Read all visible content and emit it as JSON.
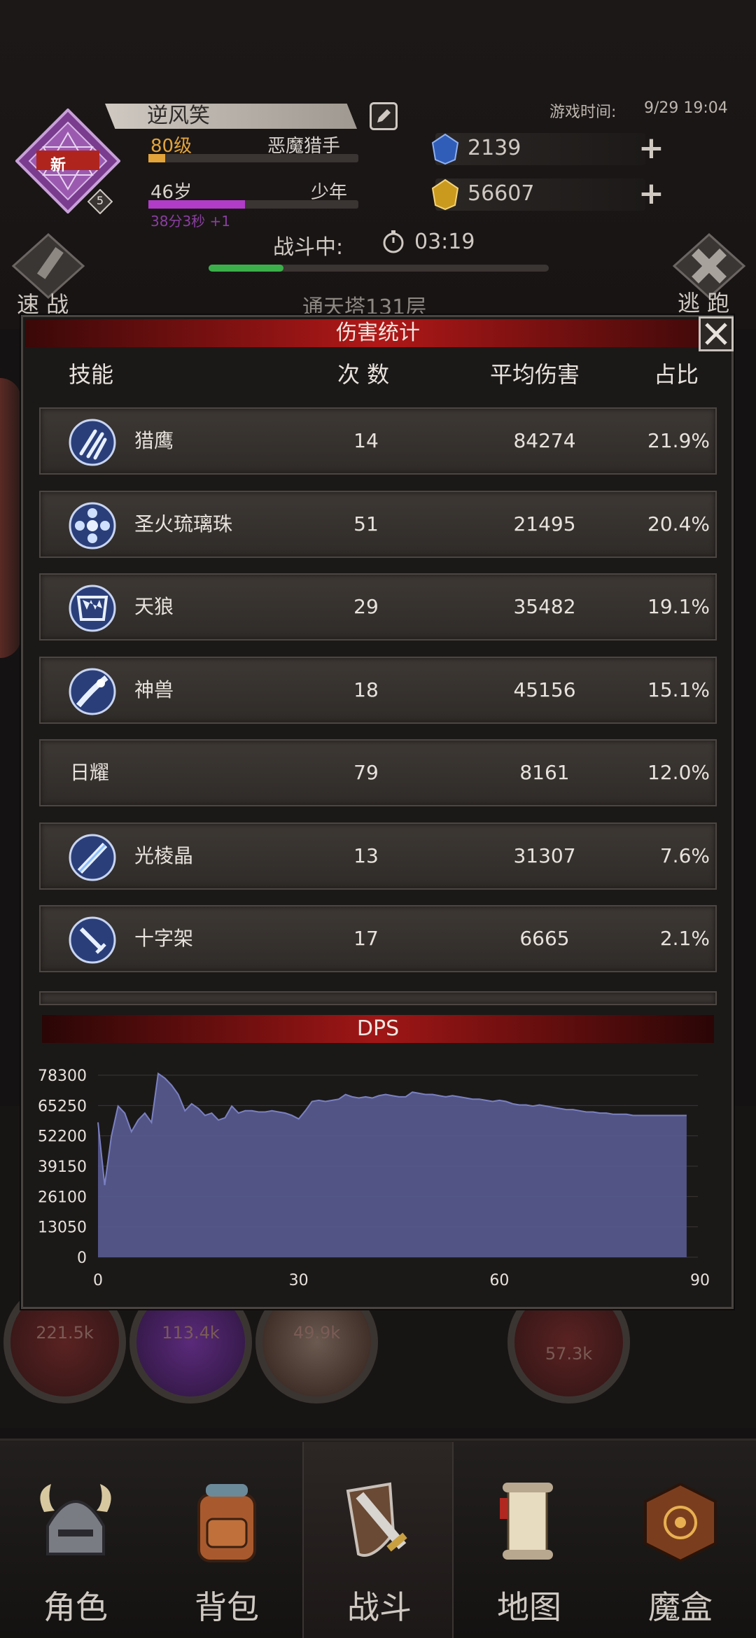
{
  "header": {
    "player_name": "逆风笑",
    "avatar_badge": "新",
    "avatar_level": "5",
    "level_text": "80级",
    "job": "恶魔猎手",
    "age": "46岁",
    "stage": "少年",
    "age_progress": "38分3秒 +1",
    "game_time_label": "游戏时间:",
    "game_time": "9/29 19:04",
    "gems": "2139",
    "gold": "56607",
    "battle_label": "战斗中:",
    "battle_timer": "03:19",
    "battle_progress": 0.22,
    "speed_label": "速 战",
    "flee_label": "逃 跑",
    "tower": "通天塔131层"
  },
  "background_bubbles": [
    "221.5k",
    "113.4k",
    "49.9k",
    "57.3k"
  ],
  "panel": {
    "title": "伤害统计",
    "columns": {
      "skill": "技能",
      "count": "次 数",
      "avg": "平均伤害",
      "pct": "占比"
    },
    "rows": [
      {
        "icon": "claw-strike-icon",
        "skill": "猎鹰",
        "count": "14",
        "avg": "84274",
        "pct": "21.9%"
      },
      {
        "icon": "orb-burst-icon",
        "skill": "圣火琉璃珠",
        "count": "51",
        "avg": "21495",
        "pct": "20.4%"
      },
      {
        "icon": "wolf-fang-icon",
        "skill": "天狼",
        "count": "29",
        "avg": "35482",
        "pct": "19.1%"
      },
      {
        "icon": "beast-wave-icon",
        "skill": "神兽",
        "count": "18",
        "avg": "45156",
        "pct": "15.1%"
      },
      {
        "icon": "",
        "skill": "日耀",
        "count": "79",
        "avg": "8161",
        "pct": "12.0%"
      },
      {
        "icon": "crystal-beam-icon",
        "skill": "光棱晶",
        "count": "13",
        "avg": "31307",
        "pct": "7.6%"
      },
      {
        "icon": "sword-cross-icon",
        "skill": "十字架",
        "count": "17",
        "avg": "6665",
        "pct": "2.1%"
      }
    ],
    "dps_title": "DPS"
  },
  "chart_data": {
    "type": "area",
    "title": "DPS",
    "xlabel": "",
    "ylabel": "",
    "xlim": [
      0,
      90
    ],
    "ylim": [
      0,
      78300
    ],
    "x_ticks": [
      0,
      30,
      60,
      90
    ],
    "y_ticks": [
      0,
      13050,
      26100,
      39150,
      52200,
      65250,
      78300
    ],
    "grid": true,
    "color": "#5a5f99",
    "x": [
      0,
      1,
      2,
      3,
      4,
      5,
      6,
      7,
      8,
      9,
      10,
      11,
      12,
      13,
      14,
      15,
      16,
      17,
      18,
      19,
      20,
      21,
      22,
      23,
      24,
      25,
      26,
      27,
      28,
      29,
      30,
      31,
      32,
      33,
      34,
      35,
      36,
      37,
      38,
      39,
      40,
      41,
      42,
      43,
      44,
      45,
      46,
      47,
      48,
      49,
      50,
      51,
      52,
      53,
      54,
      55,
      56,
      57,
      58,
      59,
      60,
      61,
      62,
      63,
      64,
      65,
      66,
      67,
      68,
      69,
      70,
      71,
      72,
      73,
      74,
      75,
      76,
      77,
      78,
      79,
      80,
      81,
      82,
      83,
      84,
      85,
      86,
      87,
      88
    ],
    "values": [
      58000,
      31000,
      52000,
      65000,
      62000,
      54000,
      59000,
      62000,
      58000,
      79000,
      77000,
      74000,
      70000,
      63000,
      66000,
      64000,
      61000,
      62000,
      59000,
      60000,
      65000,
      62000,
      63000,
      63000,
      62500,
      62500,
      63000,
      62500,
      62000,
      61000,
      59500,
      63000,
      67000,
      67500,
      67000,
      67500,
      68000,
      70000,
      69000,
      68500,
      69000,
      68500,
      69500,
      70000,
      69500,
      69000,
      69000,
      71000,
      70500,
      70000,
      70000,
      69500,
      69000,
      69500,
      69000,
      68500,
      68000,
      68000,
      67500,
      67000,
      67500,
      67000,
      66000,
      65500,
      65500,
      65000,
      65500,
      65000,
      64500,
      64000,
      63500,
      63500,
      63000,
      62500,
      62500,
      62000,
      62000,
      61500,
      61500,
      61500,
      61000,
      61000,
      61000,
      61000,
      61000,
      61000,
      61000,
      61000,
      61000
    ]
  },
  "nav": [
    {
      "label": "角色",
      "icon": "helmet-icon"
    },
    {
      "label": "背包",
      "icon": "backpack-icon"
    },
    {
      "label": "战斗",
      "icon": "sword-shield-icon"
    },
    {
      "label": "地图",
      "icon": "scroll-map-icon"
    },
    {
      "label": "魔盒",
      "icon": "magic-box-icon"
    }
  ]
}
